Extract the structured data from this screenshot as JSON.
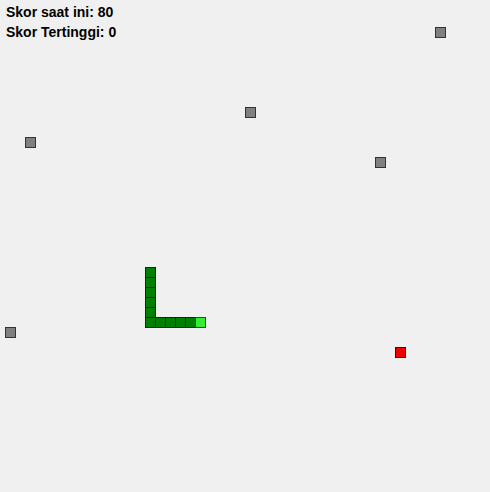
{
  "hud": {
    "score_label": "Skor saat ini: 80",
    "high_score_label": "Skor Tertinggi: 0"
  },
  "board": {
    "snake": [
      {
        "x": 19,
        "y": 31,
        "kind": "head"
      },
      {
        "x": 18,
        "y": 31,
        "kind": "body"
      },
      {
        "x": 17,
        "y": 31,
        "kind": "body"
      },
      {
        "x": 16,
        "y": 31,
        "kind": "body"
      },
      {
        "x": 15,
        "y": 31,
        "kind": "body"
      },
      {
        "x": 14,
        "y": 31,
        "kind": "body"
      },
      {
        "x": 14,
        "y": 30,
        "kind": "body"
      },
      {
        "x": 14,
        "y": 29,
        "kind": "body"
      },
      {
        "x": 14,
        "y": 28,
        "kind": "body"
      },
      {
        "x": 14,
        "y": 27,
        "kind": "body"
      },
      {
        "x": 14,
        "y": 26,
        "kind": "body"
      }
    ],
    "food": {
      "x": 39,
      "y": 34
    },
    "obstacles": [
      {
        "x": 43,
        "y": 2
      },
      {
        "x": 24,
        "y": 10
      },
      {
        "x": 2,
        "y": 13
      },
      {
        "x": 37,
        "y": 15
      },
      {
        "x": 0,
        "y": 32
      }
    ]
  }
}
